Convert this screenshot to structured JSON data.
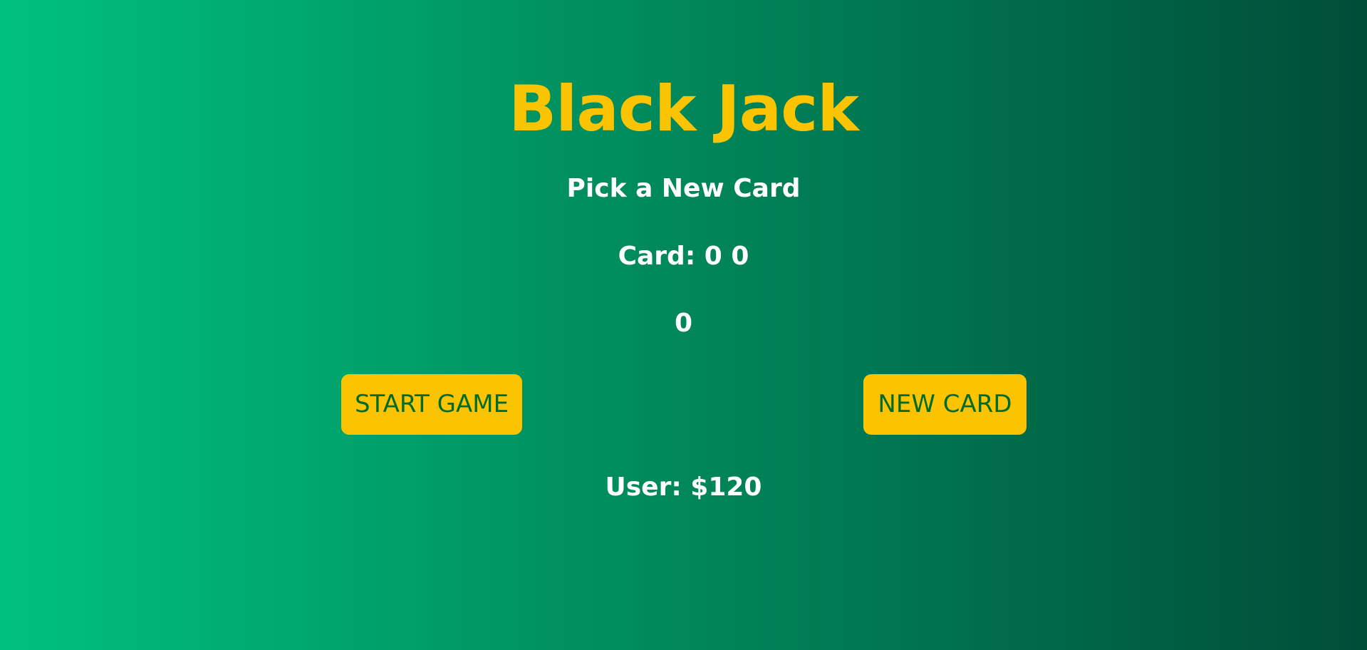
{
  "game": {
    "title": "Black Jack",
    "message": "Pick a New Card",
    "cards_text": "Card: 0 0",
    "sum_text": "0",
    "player_text": "User: $120"
  },
  "buttons": {
    "start_label": "START GAME",
    "new_card_label": "NEW CARD"
  },
  "colors": {
    "accent": "#fcc400",
    "button_text": "#006b2c",
    "gradient_start": "#00c080",
    "gradient_end": "#004d38",
    "text": "#ffffff"
  }
}
